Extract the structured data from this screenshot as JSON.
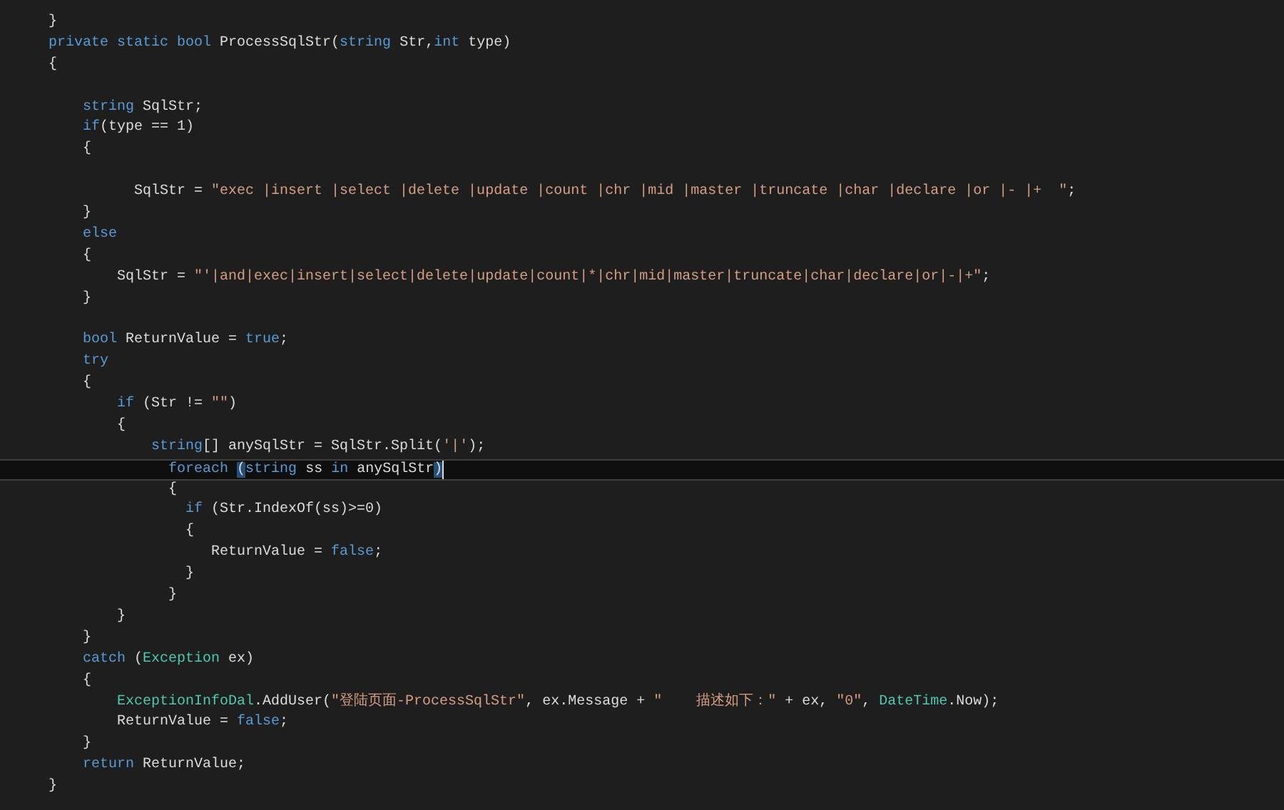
{
  "lines": [
    {
      "current": false,
      "tokens": [
        {
          "kind": "plain",
          "text": "}"
        }
      ]
    },
    {
      "current": false,
      "tokens": [
        {
          "kind": "keyword",
          "text": "private static bool"
        },
        {
          "kind": "plain",
          "text": " ProcessSqlStr("
        },
        {
          "kind": "keyword",
          "text": "string"
        },
        {
          "kind": "plain",
          "text": " Str,"
        },
        {
          "kind": "keyword",
          "text": "int"
        },
        {
          "kind": "plain",
          "text": " type)"
        }
      ]
    },
    {
      "current": false,
      "tokens": [
        {
          "kind": "plain",
          "text": "{"
        }
      ]
    },
    {
      "current": false
    },
    {
      "current": false,
      "tokens": [
        {
          "kind": "keyword",
          "text": "    string"
        },
        {
          "kind": "plain",
          "text": " SqlStr;"
        }
      ]
    },
    {
      "current": false,
      "tokens": [
        {
          "kind": "keyword",
          "text": "    if"
        },
        {
          "kind": "plain",
          "text": "(type == 1)"
        }
      ]
    },
    {
      "current": false,
      "tokens": [
        {
          "kind": "plain",
          "text": "    {"
        }
      ]
    },
    {
      "current": false
    },
    {
      "current": false,
      "tokens": [
        {
          "kind": "plain",
          "text": "          SqlStr = "
        },
        {
          "kind": "string",
          "text": "\"exec |insert |select |delete |update |count |chr |mid |master |truncate |char |declare |or |- |+  \""
        },
        {
          "kind": "plain",
          "text": ";"
        }
      ]
    },
    {
      "current": false,
      "tokens": [
        {
          "kind": "plain",
          "text": "    }"
        }
      ]
    },
    {
      "current": false,
      "tokens": [
        {
          "kind": "keyword",
          "text": "    else"
        }
      ]
    },
    {
      "current": false,
      "tokens": [
        {
          "kind": "plain",
          "text": "    {"
        }
      ]
    },
    {
      "current": false,
      "tokens": [
        {
          "kind": "plain",
          "text": "        SqlStr = "
        },
        {
          "kind": "string",
          "text": "\"'|and|exec|insert|select|delete|update|count|*|chr|mid|master|truncate|char|declare|or|-|+\""
        },
        {
          "kind": "plain",
          "text": ";"
        }
      ]
    },
    {
      "current": false,
      "tokens": [
        {
          "kind": "plain",
          "text": "    }"
        }
      ]
    },
    {
      "current": false
    },
    {
      "current": false,
      "tokens": [
        {
          "kind": "keyword",
          "text": "    bool"
        },
        {
          "kind": "plain",
          "text": " ReturnValue = "
        },
        {
          "kind": "keyword",
          "text": "true"
        },
        {
          "kind": "plain",
          "text": ";"
        }
      ]
    },
    {
      "current": false,
      "tokens": [
        {
          "kind": "keyword",
          "text": "    try"
        }
      ]
    },
    {
      "current": false,
      "tokens": [
        {
          "kind": "plain",
          "text": "    {"
        }
      ]
    },
    {
      "current": false,
      "tokens": [
        {
          "kind": "keyword",
          "text": "        if"
        },
        {
          "kind": "plain",
          "text": " (Str != "
        },
        {
          "kind": "string",
          "text": "\"\""
        },
        {
          "kind": "plain",
          "text": ")"
        }
      ]
    },
    {
      "current": false,
      "tokens": [
        {
          "kind": "plain",
          "text": "        {"
        }
      ]
    },
    {
      "current": false,
      "tokens": [
        {
          "kind": "keyword",
          "text": "            string"
        },
        {
          "kind": "plain",
          "text": "[] anySqlStr = SqlStr.Split("
        },
        {
          "kind": "string",
          "text": "'|'"
        },
        {
          "kind": "plain",
          "text": ");"
        }
      ]
    },
    {
      "current": true,
      "tokens": [
        {
          "kind": "keyword",
          "text": "              foreach "
        },
        {
          "kind": "matched_brace",
          "text": "("
        },
        {
          "kind": "keyword",
          "text": "string"
        },
        {
          "kind": "plain",
          "text": " ss "
        },
        {
          "kind": "keyword",
          "text": "in"
        },
        {
          "kind": "plain",
          "text": " anySqlStr"
        },
        {
          "kind": "matched_brace",
          "text": ")"
        }
      ]
    },
    {
      "current": false,
      "tokens": [
        {
          "kind": "plain",
          "text": "              {"
        }
      ]
    },
    {
      "current": false,
      "tokens": [
        {
          "kind": "keyword",
          "text": "                if"
        },
        {
          "kind": "plain",
          "text": " (Str.IndexOf(ss)>=0)"
        }
      ]
    },
    {
      "current": false,
      "tokens": [
        {
          "kind": "plain",
          "text": "                {"
        }
      ]
    },
    {
      "current": false,
      "tokens": [
        {
          "kind": "plain",
          "text": "                   ReturnValue = "
        },
        {
          "kind": "keyword",
          "text": "false"
        },
        {
          "kind": "plain",
          "text": ";"
        }
      ]
    },
    {
      "current": false,
      "tokens": [
        {
          "kind": "plain",
          "text": "                }"
        }
      ]
    },
    {
      "current": false,
      "tokens": [
        {
          "kind": "plain",
          "text": "              }"
        }
      ]
    },
    {
      "current": false,
      "tokens": [
        {
          "kind": "plain",
          "text": "        }"
        }
      ]
    },
    {
      "current": false,
      "tokens": [
        {
          "kind": "plain",
          "text": "    }"
        }
      ]
    },
    {
      "current": false,
      "tokens": [
        {
          "kind": "keyword",
          "text": "    catch"
        },
        {
          "kind": "plain",
          "text": " ("
        },
        {
          "kind": "type",
          "text": "Exception"
        },
        {
          "kind": "plain",
          "text": " ex)"
        }
      ]
    },
    {
      "current": false,
      "tokens": [
        {
          "kind": "plain",
          "text": "    {"
        }
      ]
    },
    {
      "current": false,
      "tokens": [
        {
          "kind": "type",
          "text": "        ExceptionInfoDal"
        },
        {
          "kind": "plain",
          "text": ".AddUser("
        },
        {
          "kind": "string",
          "text": "\"登陆页面-ProcessSqlStr\""
        },
        {
          "kind": "plain",
          "text": ", ex.Message + "
        },
        {
          "kind": "string",
          "text": "\"    描述如下：\""
        },
        {
          "kind": "plain",
          "text": " + ex, "
        },
        {
          "kind": "string",
          "text": "\"0\""
        },
        {
          "kind": "plain",
          "text": ", "
        },
        {
          "kind": "type",
          "text": "DateTime"
        },
        {
          "kind": "plain",
          "text": ".Now);"
        }
      ]
    },
    {
      "current": false,
      "tokens": [
        {
          "kind": "plain",
          "text": "        ReturnValue = "
        },
        {
          "kind": "keyword",
          "text": "false"
        },
        {
          "kind": "plain",
          "text": ";"
        }
      ]
    },
    {
      "current": false,
      "tokens": [
        {
          "kind": "plain",
          "text": "    }"
        }
      ]
    },
    {
      "current": false,
      "tokens": [
        {
          "kind": "keyword",
          "text": "    return"
        },
        {
          "kind": "plain",
          "text": " ReturnValue;"
        }
      ]
    },
    {
      "current": false,
      "tokens": [
        {
          "kind": "plain",
          "text": "}"
        }
      ]
    }
  ]
}
